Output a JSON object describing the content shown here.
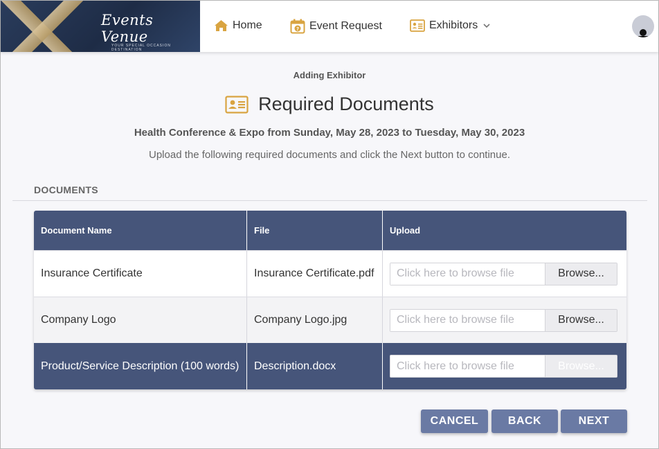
{
  "header": {
    "logo_text": "Events Venue",
    "logo_tagline": "YOUR SPECIAL OCCASION DESTINATION",
    "nav": {
      "home": "Home",
      "event_request": "Event Request",
      "exhibitors": "Exhibitors"
    }
  },
  "page": {
    "subtitle": "Adding Exhibitor",
    "title": "Required Documents",
    "event_line": "Health Conference & Expo from Sunday, May 28, 2023 to Tuesday, May 30, 2023",
    "instructions": "Upload the following required documents and click the Next button to continue."
  },
  "documents": {
    "section_label": "DOCUMENTS",
    "columns": [
      "Document Name",
      "File",
      "Upload"
    ],
    "rows": [
      {
        "name": "Insurance Certificate",
        "file": "Insurance Certificate.pdf"
      },
      {
        "name": "Company Logo",
        "file": "Company Logo.jpg"
      },
      {
        "name": "Product/Service Description (100 words)",
        "file": "Description.docx"
      }
    ],
    "upload_placeholder": "Click here to browse file",
    "browse_label": "Browse..."
  },
  "buttons": {
    "cancel": "CANCEL",
    "back": "BACK",
    "next": "NEXT"
  },
  "colors": {
    "accent": "#46557a",
    "button": "#6a7aa4",
    "icon": "#d9a441"
  }
}
